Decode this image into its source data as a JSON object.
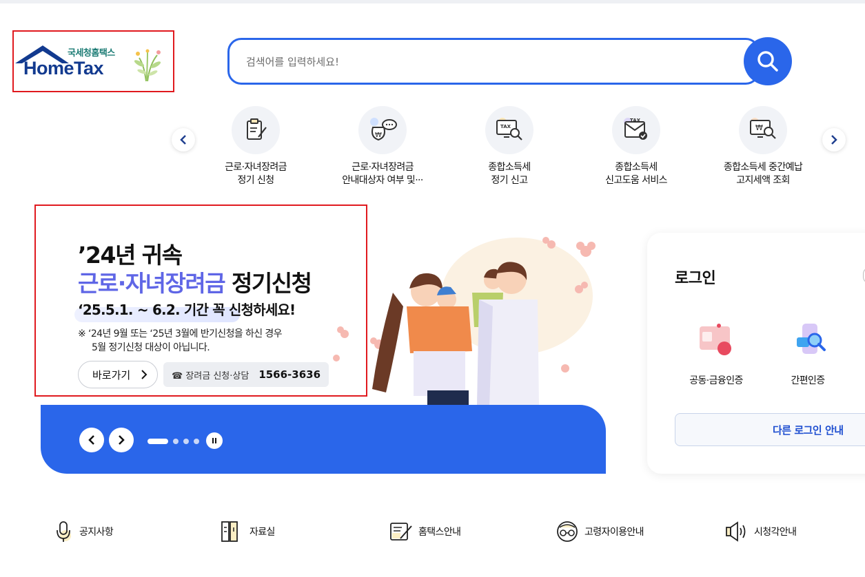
{
  "logo": {
    "korean": "국세청홈택스",
    "english": "HomeTax"
  },
  "search": {
    "placeholder": "검색어를 입력하세요!",
    "button_icon": "search-icon"
  },
  "quick_menu": {
    "items": [
      {
        "line1": "근로·자녀장려금",
        "line2": "정기 신청",
        "icon": "clipboard-pen-icon"
      },
      {
        "line1": "근로·자녀장려금",
        "line2": "안내대상자 여부 및···",
        "icon": "won-chat-icon"
      },
      {
        "line1": "종합소득세",
        "line2": "정기 신고",
        "icon": "tax-monitor-search-icon"
      },
      {
        "line1": "종합소득세",
        "line2": "신고도움 서비스",
        "icon": "tax-document-check-icon"
      },
      {
        "line1": "종합소득세 중간예납",
        "line2": "고지세액 조회",
        "icon": "won-monitor-search-icon"
      }
    ]
  },
  "banner": {
    "title_line1": "’24년 귀속",
    "title_accent": "근로·자녀장려금",
    "title_rest": " 정기신청",
    "period": "‘25.5.1. ~ 6.2. 기간 꼭 신청하세요!",
    "note_line1": "※ ‘24년 9월 또는 ‘25년 3월에 반기신청을 하신 경우",
    "note_line2": "5월 정기신청 대상이 아닙니다.",
    "go_button": "바로가기",
    "phone_label": "☎ 장려금 신청·상담",
    "phone_number": "1566-3636",
    "slide_count": 4,
    "active_slide": 1
  },
  "login": {
    "title": "로그인",
    "options": [
      {
        "label": "공동·금융인증",
        "icon": "certificate-card-icon"
      },
      {
        "label": "간편인증",
        "icon": "simple-auth-icon"
      }
    ],
    "other_button": "다른 로그인 안내"
  },
  "bottom_links": [
    {
      "label": "공지사항",
      "icon": "microphone-icon"
    },
    {
      "label": "자료실",
      "icon": "archive-icon"
    },
    {
      "label": "홈택스안내",
      "icon": "document-pen-icon"
    },
    {
      "label": "고령자이용안내",
      "icon": "senior-glasses-icon"
    },
    {
      "label": "시청각안내",
      "icon": "speaker-icon"
    }
  ],
  "colors": {
    "primary": "#2a66ea",
    "accent_purple": "#5f66e6",
    "highlight_border": "#e0191e"
  }
}
